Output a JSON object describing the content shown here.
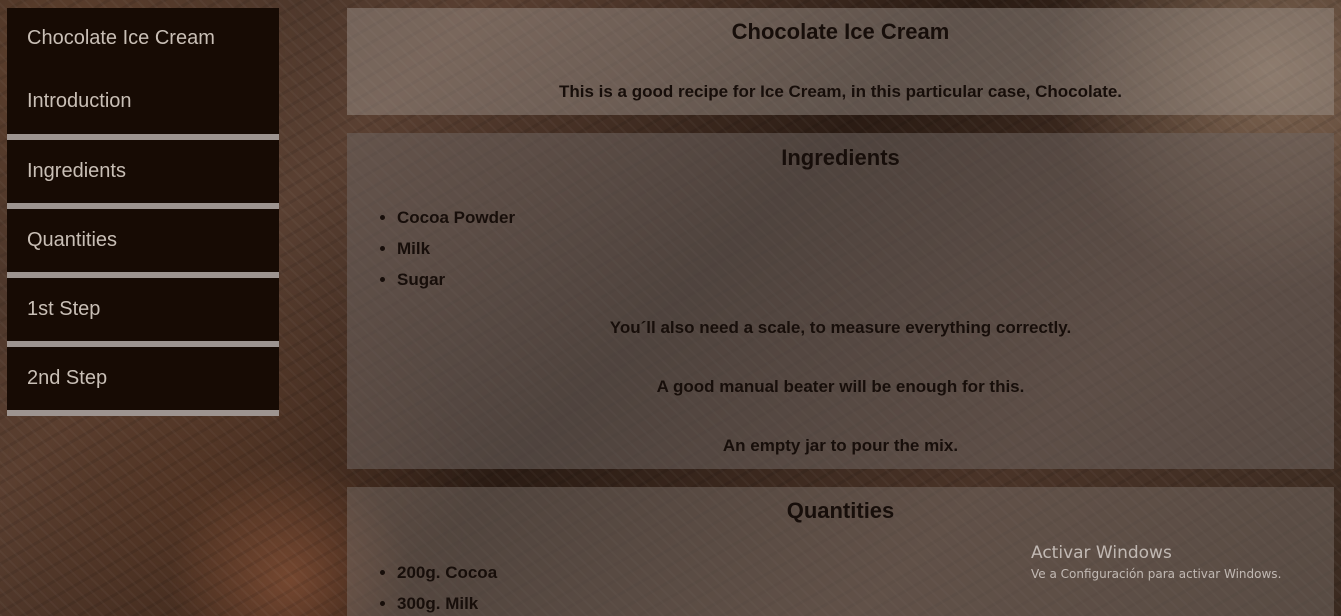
{
  "nav": {
    "items": [
      {
        "label": "Chocolate Ice Cream"
      },
      {
        "label": "Introduction"
      },
      {
        "label": "Ingredients"
      },
      {
        "label": "Quantities"
      },
      {
        "label": "1st Step"
      },
      {
        "label": "2nd Step"
      }
    ]
  },
  "intro": {
    "title": "Chocolate Ice Cream",
    "text": "This is a good recipe for Ice Cream, in this particular case, Chocolate."
  },
  "ingredients": {
    "title": "Ingredients",
    "items": [
      "Cocoa Powder",
      "Milk",
      "Sugar"
    ],
    "notes": [
      "You´ll also need a scale, to measure everything correctly.",
      "A good manual beater will be enough for this.",
      "An empty jar to pour the mix."
    ]
  },
  "quantities": {
    "title": "Quantities",
    "items": [
      "200g. Cocoa",
      "300g. Milk"
    ]
  },
  "watermark": {
    "title": "Activar Windows",
    "subtitle": "Ve a Configuración para activar Windows."
  }
}
